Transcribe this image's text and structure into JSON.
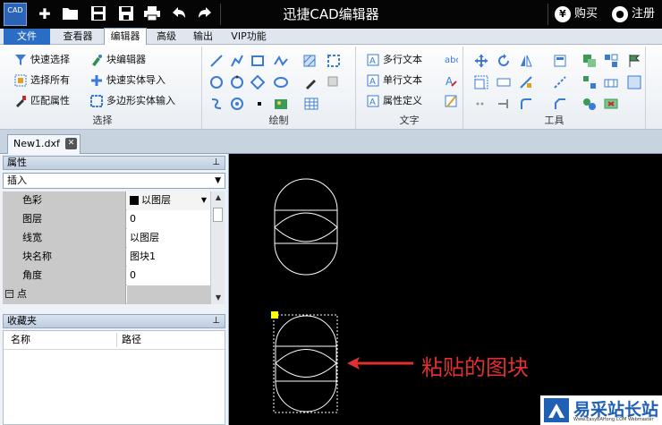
{
  "app": {
    "title": "迅捷CAD编辑器",
    "logo_text": "CAD",
    "buy_label": "购买",
    "register_label": "注册"
  },
  "menu": {
    "file": "文件",
    "tabs": [
      "查看器",
      "编辑器",
      "高级",
      "输出",
      "VIP功能"
    ],
    "active_tab": "编辑器"
  },
  "ribbon": {
    "select_group": {
      "label": "选择",
      "quick_select": "快速选择",
      "select_all": "选择所有",
      "match_props": "匹配属性",
      "block_editor": "块编辑器",
      "quick_entity_import": "快速实体导入",
      "polygon_entity_input": "多边形实体输入"
    },
    "draw_group": {
      "label": "绘制"
    },
    "text_group": {
      "label": "文字",
      "mtext": "多行文本",
      "stext": "单行文本",
      "attdef": "属性定义"
    },
    "tools_group": {
      "label": "工具"
    }
  },
  "document": {
    "tab_name": "New1.dxf"
  },
  "properties": {
    "header": "属性",
    "combo_value": "插入",
    "rows": [
      {
        "key": "色彩",
        "value": "以图层"
      },
      {
        "key": "图层",
        "value": "0"
      },
      {
        "key": "线宽",
        "value": "以图层"
      },
      {
        "key": "块名称",
        "value": "图块1"
      },
      {
        "key": "角度",
        "value": "0"
      },
      {
        "key": "点",
        "value": ""
      }
    ]
  },
  "favorites": {
    "header": "收藏夹",
    "col_name": "名称",
    "col_path": "路径"
  },
  "canvas": {
    "annotation": "粘贴的图块"
  },
  "watermark": {
    "text": "易采站长站",
    "sub": "Www.EasyBAHong.COM Webmaster"
  },
  "colors": {
    "accent": "#2b6cc4",
    "canvas_bg": "#000000",
    "annotation": "#e03030",
    "grip": "#ffff00"
  }
}
